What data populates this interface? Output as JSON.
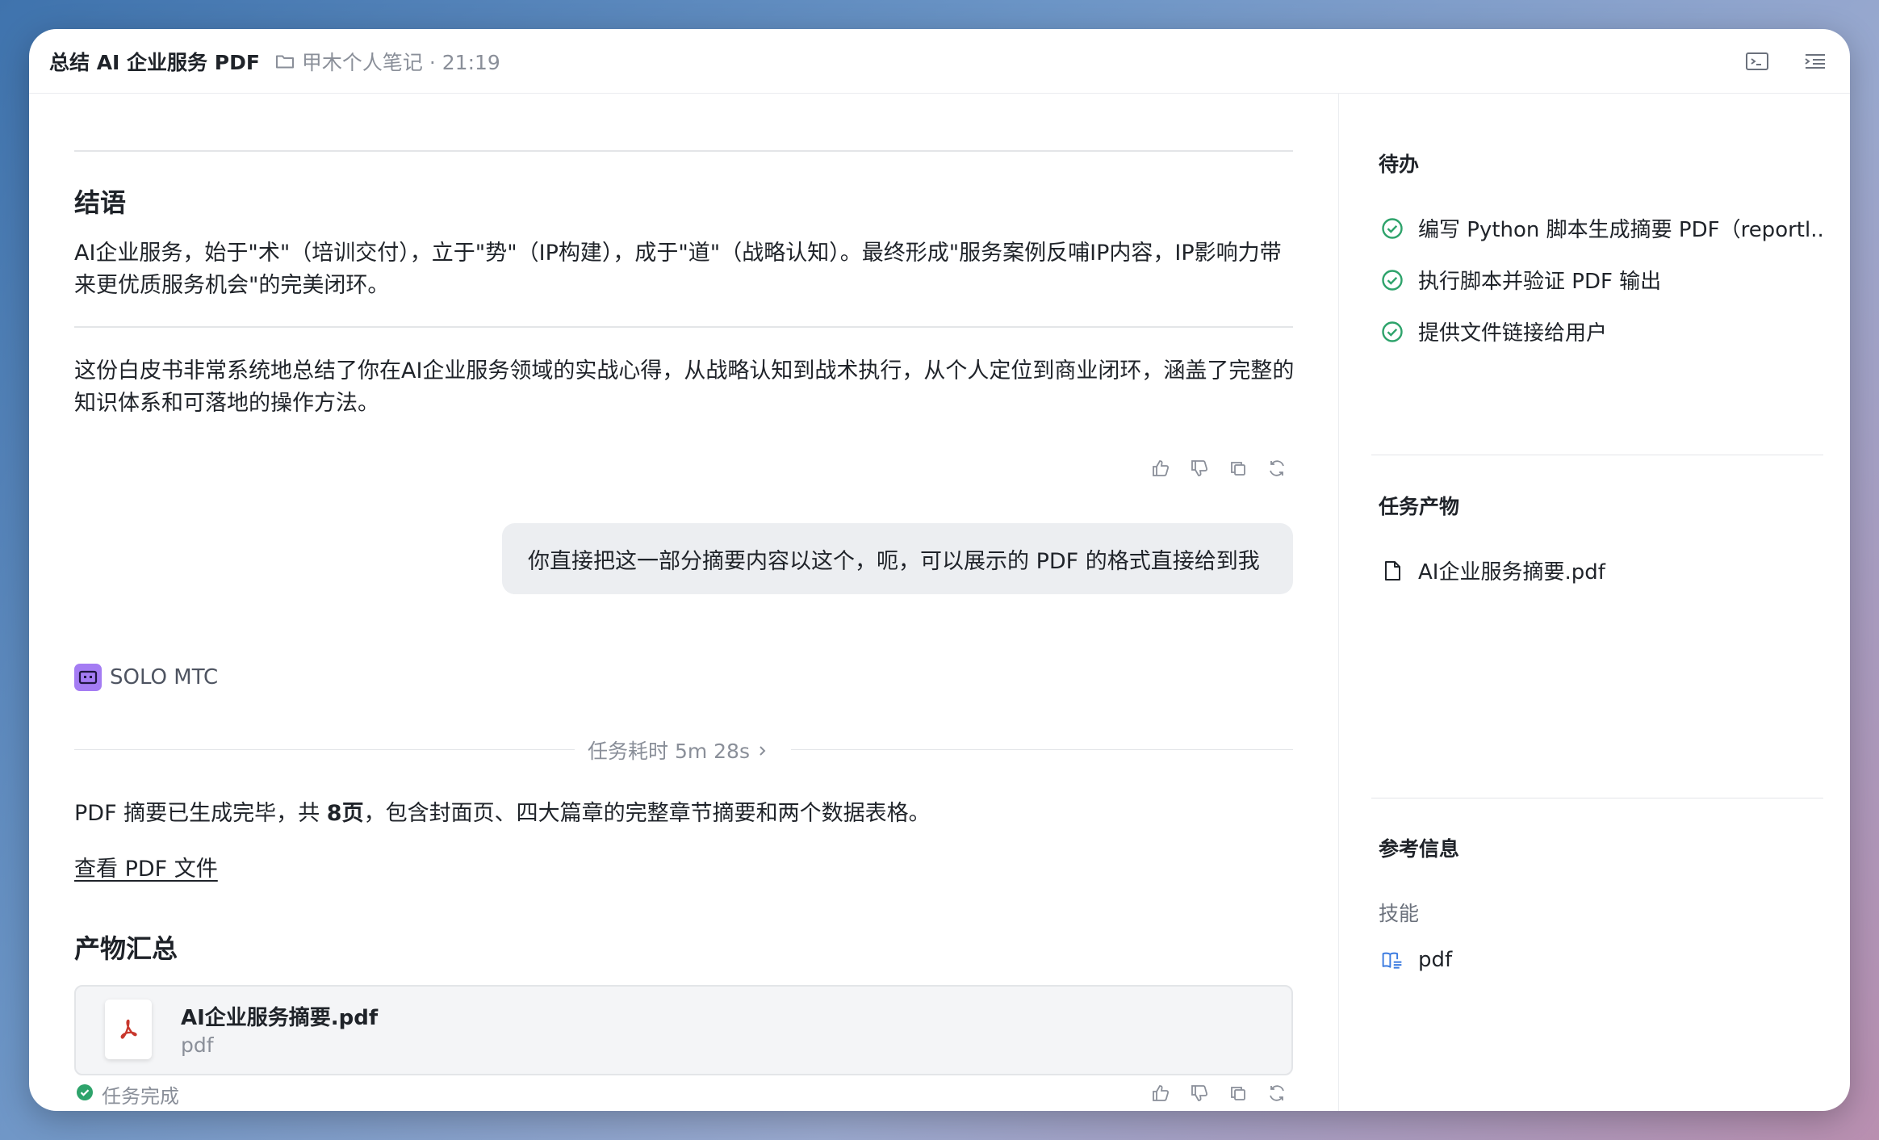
{
  "header": {
    "title": "总结 AI 企业服务 PDF",
    "breadcrumb": "甲木个人笔记 · 21:19"
  },
  "main": {
    "conclusion_heading": "结语",
    "conclusion_text": "AI企业服务，始于\"术\"（培训交付），立于\"势\"（IP构建），成于\"道\"（战略认知）。最终形成\"服务案例反哺IP内容，IP影响力带来更优质服务机会\"的完美闭环。",
    "summary_text": "这份白皮书非常系统地总结了你在AI企业服务领域的实战心得，从战略认知到战术执行，从个人定位到商业闭环，涵盖了完整的知识体系和可落地的操作方法。",
    "user_message": "你直接把这一部分摘要内容以这个，呃，可以展示的 PDF 的格式直接给到我",
    "agent_name": "SOLO MTC",
    "task_duration": "任务耗时 5m 28s",
    "result_pre": "PDF 摘要已生成完毕，共 ",
    "result_bold": "8页",
    "result_post": "，包含封面页、四大篇章的完整章节摘要和两个数据表格。",
    "view_link": "查看 PDF 文件",
    "deliverables_heading": "产物汇总",
    "file_name": "AI企业服务摘要.pdf",
    "file_type": "pdf",
    "status": "任务完成"
  },
  "sidebar": {
    "todo_title": "待办",
    "todos": [
      "编写 Python 脚本生成摘要 PDF（reportl...",
      "执行脚本并验证 PDF 输出",
      "提供文件链接给用户"
    ],
    "artifacts_title": "任务产物",
    "artifact": "AI企业服务摘要.pdf",
    "reference_title": "参考信息",
    "skills_label": "技能",
    "skill": "pdf"
  },
  "colors": {
    "check_green": "#2ea36b",
    "agent_purple": "#a47cf3",
    "pdf_red": "#c8372d",
    "skill_blue": "#3b7be0"
  }
}
